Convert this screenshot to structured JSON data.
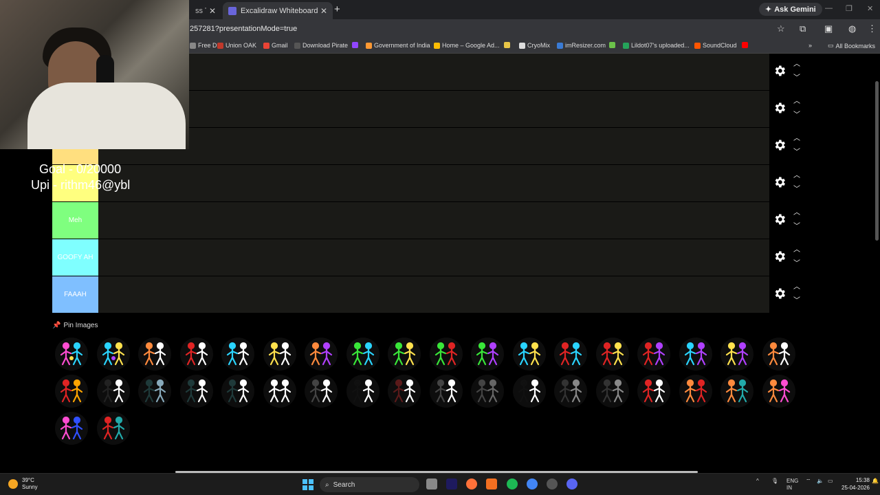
{
  "browser": {
    "tabs": [
      {
        "label": "ss Tier",
        "state": "inactive"
      },
      {
        "label": "Excalidraw Whiteboard",
        "state": "active"
      }
    ],
    "new_tab": "+",
    "close_glyph": "✕",
    "ask_gemini": "Ask Gemini",
    "url": "257281?presentationMode=true",
    "bookmarks": [
      {
        "label": "Free D...",
        "color": "#888888"
      },
      {
        "label": "Union OAK",
        "color": "#c0392b"
      },
      {
        "label": "Gmail",
        "color": "#ea4335"
      },
      {
        "label": "Download Pirate",
        "color": "#555555"
      },
      {
        "label": "",
        "color": "#9146ff"
      },
      {
        "label": "Government of India",
        "color": "#ff9933"
      },
      {
        "label": "Home – Google Ad...",
        "color": "#fbbc04"
      },
      {
        "label": "",
        "color": "#e8c547"
      },
      {
        "label": "CryoMix",
        "color": "#dddddd"
      },
      {
        "label": "imResizer.com",
        "color": "#3a7bd5"
      },
      {
        "label": "",
        "color": "#6cc24a"
      },
      {
        "label": "Lildot07's uploaded...",
        "color": "#25a35a"
      },
      {
        "label": "SoundCloud",
        "color": "#ff5500"
      },
      {
        "label": "",
        "color": "#ff0000"
      }
    ],
    "more_bookmarks": "»",
    "all_bookmarks": "All Bookmarks"
  },
  "overlay": {
    "goal": "Goal - 0/20000",
    "upi": "Upi - rithm46@ybl"
  },
  "tiers": [
    {
      "label": "",
      "color": "#ff7f7f"
    },
    {
      "label": "",
      "color": "#ffbf7f"
    },
    {
      "label": "",
      "color": "#ffdf7f"
    },
    {
      "label": "",
      "color": "#ffff7f"
    },
    {
      "label": "Meh",
      "color": "#7fff7f"
    },
    {
      "label": "GOOFY AH",
      "color": "#7fffff"
    },
    {
      "label": "FAAAH",
      "color": "#7fbfff"
    }
  ],
  "pin_images_label": "Pin Images",
  "thumbnails": [
    {
      "colors": [
        "#ff4dd2",
        "#2ad4ff",
        "#ffe14d"
      ]
    },
    {
      "colors": [
        "#2ad4ff",
        "#ffe14d",
        "#b040ff"
      ]
    },
    {
      "colors": [
        "#ff8a3d",
        "#ffffff"
      ]
    },
    {
      "colors": [
        "#e02424",
        "#ffffff"
      ]
    },
    {
      "colors": [
        "#2ad4ff",
        "#ffffff"
      ]
    },
    {
      "colors": [
        "#ffe14d",
        "#ffffff"
      ]
    },
    {
      "colors": [
        "#ff8a3d",
        "#b040ff"
      ]
    },
    {
      "colors": [
        "#39e639",
        "#2ad4ff"
      ]
    },
    {
      "colors": [
        "#39e639",
        "#ffe14d"
      ]
    },
    {
      "colors": [
        "#39e639",
        "#e02424"
      ]
    },
    {
      "colors": [
        "#39e639",
        "#b040ff"
      ]
    },
    {
      "colors": [
        "#2ad4ff",
        "#ffe14d"
      ]
    },
    {
      "colors": [
        "#e02424",
        "#2ad4ff"
      ]
    },
    {
      "colors": [
        "#e02424",
        "#ffe14d"
      ]
    },
    {
      "colors": [
        "#e02424",
        "#b040ff"
      ]
    },
    {
      "colors": [
        "#2ad4ff",
        "#b040ff"
      ]
    },
    {
      "colors": [
        "#ffe14d",
        "#b040ff"
      ]
    },
    {
      "colors": [
        "#ff8a3d",
        "#ffffff"
      ]
    },
    {
      "colors": [
        "#e02424",
        "#ffa500"
      ]
    },
    {
      "colors": [
        "#222222",
        "#ffffff"
      ]
    },
    {
      "colors": [
        "#1f3a3a",
        "#8ab"
      ]
    },
    {
      "colors": [
        "#1f3a3a",
        "#ffffff"
      ]
    },
    {
      "colors": [
        "#1f3a3a",
        "#ffffff"
      ]
    },
    {
      "colors": [
        "#ffffff",
        "#ffffff"
      ]
    },
    {
      "colors": [
        "#444444",
        "#ffffff"
      ]
    },
    {
      "colors": [
        "#111111",
        "#ffffff"
      ]
    },
    {
      "colors": [
        "#5a1a1a",
        "#ffffff"
      ]
    },
    {
      "colors": [
        "#444444",
        "#ffffff"
      ]
    },
    {
      "colors": [
        "#444444",
        "#666666"
      ]
    },
    {
      "colors": [
        "#111111",
        "#ffffff"
      ]
    },
    {
      "colors": [
        "#333333",
        "#888888"
      ]
    },
    {
      "colors": [
        "#333333",
        "#888888"
      ]
    },
    {
      "colors": [
        "#e02424",
        "#ffffff"
      ]
    },
    {
      "colors": [
        "#ff8a3d",
        "#e02424"
      ]
    },
    {
      "colors": [
        "#ff8a3d",
        "#2aa"
      ]
    },
    {
      "colors": [
        "#ff8a3d",
        "#ff4dd2"
      ]
    },
    {
      "colors": [
        "#ff4dd2",
        "#3050ff"
      ]
    },
    {
      "colors": [
        "#e02424",
        "#2aa"
      ]
    }
  ],
  "taskbar": {
    "temp": "39°C",
    "condition": "Sunny",
    "search": "Search",
    "lang": "ENG",
    "region": "IN",
    "time": "15:38",
    "date": "25-04-2026"
  }
}
